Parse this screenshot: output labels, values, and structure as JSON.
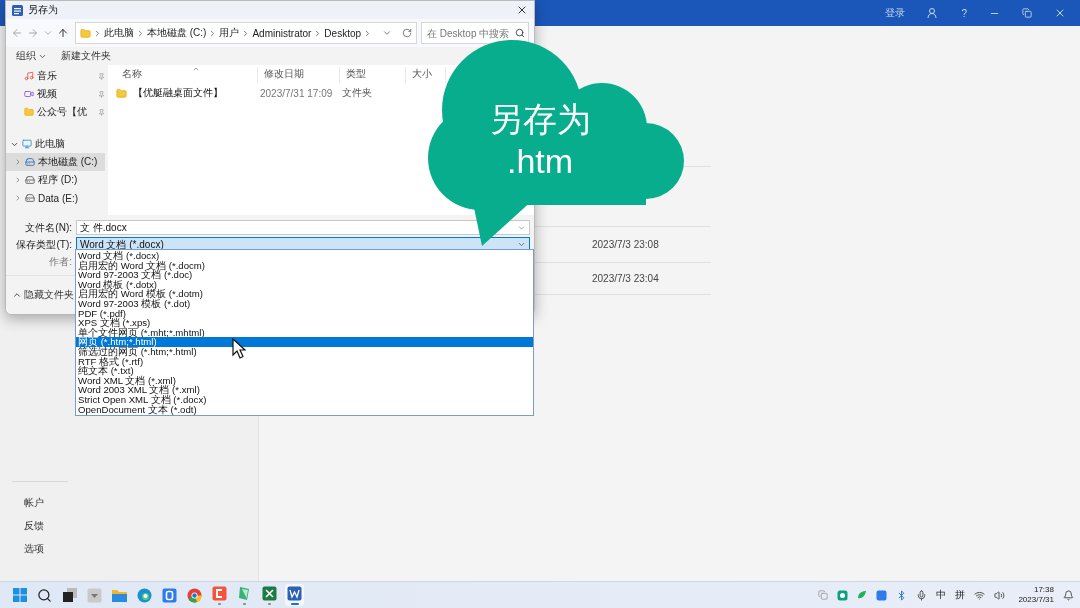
{
  "word_window": {
    "sign_in": "登录",
    "help": "?"
  },
  "backstage": {
    "bottom_items": [
      "帐户",
      "反馈",
      "选项"
    ],
    "recent_rows": [
      {
        "date": "2023/7/3 23:08"
      },
      {
        "date": "2023/7/3 23:04"
      }
    ]
  },
  "dialog": {
    "title": "另存为",
    "nav_buttons": [
      {
        "kind": "back",
        "disabled": true
      },
      {
        "kind": "forward",
        "disabled": true
      },
      {
        "kind": "recent",
        "disabled": true
      },
      {
        "kind": "up",
        "disabled": false
      }
    ],
    "address": [
      "此电脑",
      "本地磁盘 (C:)",
      "用户",
      "Administrator",
      "Desktop"
    ],
    "search": {
      "placeholder": "在 Desktop 中搜索"
    },
    "toolbar": [
      {
        "label": "组织",
        "menu": true
      },
      {
        "label": "新建文件夹",
        "menu": false
      }
    ],
    "quick_access": [
      {
        "label": "音乐",
        "kind": "music",
        "pinned": true
      },
      {
        "label": "视频",
        "kind": "video",
        "pinned": true
      },
      {
        "label": "公众号【优",
        "kind": "folder",
        "pinned": true
      }
    ],
    "tree": [
      {
        "label": "此电脑",
        "kind": "pc",
        "expanded": true,
        "selected": false,
        "children": [
          {
            "label": "本地磁盘 (C:)",
            "kind": "system-drive",
            "expanded": false,
            "selected": true
          },
          {
            "label": "程序 (D:)",
            "kind": "drive",
            "expanded": false,
            "selected": false
          },
          {
            "label": "Data (E:)",
            "kind": "drive",
            "expanded": false,
            "selected": false
          }
        ]
      }
    ],
    "columns": [
      "名称",
      "修改日期",
      "类型",
      "大小"
    ],
    "files": [
      {
        "name": "【优艇融桌面文件】",
        "modified": "2023/7/31 17:09",
        "type": "文件夹"
      }
    ],
    "filename": {
      "label": "文件名(N):",
      "value": "文 件.docx"
    },
    "filetype": {
      "label": "保存类型(T):",
      "value": "Word 文档 (*.docx)"
    },
    "author": {
      "label": "作者:"
    },
    "hide_folders": "隐藏文件夹",
    "filetype_options": [
      {
        "label": "Word 文档 (*.docx)",
        "selected": false
      },
      {
        "label": "启用宏的 Word 文档 (*.docm)",
        "selected": false
      },
      {
        "label": "Word 97-2003 文档 (*.doc)",
        "selected": false
      },
      {
        "label": "Word 模板 (*.dotx)",
        "selected": false
      },
      {
        "label": "启用宏的 Word 模板 (*.dotm)",
        "selected": false
      },
      {
        "label": "Word 97-2003 模板 (*.dot)",
        "selected": false
      },
      {
        "label": "PDF (*.pdf)",
        "selected": false
      },
      {
        "label": "XPS 文档 (*.xps)",
        "selected": false
      },
      {
        "label": "单个文件网页 (*.mht;*.mhtml)",
        "selected": false
      },
      {
        "label": "网页 (*.htm;*.html)",
        "selected": true
      },
      {
        "label": "筛选过的网页 (*.htm;*.html)",
        "selected": false
      },
      {
        "label": "RTF 格式 (*.rtf)",
        "selected": false
      },
      {
        "label": "纯文本 (*.txt)",
        "selected": false
      },
      {
        "label": "Word XML 文档 (*.xml)",
        "selected": false
      },
      {
        "label": "Word 2003 XML 文档 (*.xml)",
        "selected": false
      },
      {
        "label": "Strict Open XML 文档 (*.docx)",
        "selected": false
      },
      {
        "label": "OpenDocument 文本 (*.odt)",
        "selected": false
      }
    ]
  },
  "callout": {
    "lines": [
      "另存为",
      ".htm"
    ]
  },
  "taskbar": {
    "apps": [
      {
        "kind": "start",
        "running": false,
        "active": false
      },
      {
        "kind": "search",
        "running": false,
        "active": false
      },
      {
        "kind": "taskview",
        "running": false,
        "active": false
      },
      {
        "kind": "grey",
        "running": false,
        "active": false
      },
      {
        "kind": "explorer",
        "running": false,
        "active": false
      },
      {
        "kind": "edge",
        "running": false,
        "active": false
      },
      {
        "kind": "blue",
        "running": false,
        "active": false
      },
      {
        "kind": "chrome",
        "running": false,
        "active": false
      },
      {
        "kind": "red",
        "running": true,
        "active": false
      },
      {
        "kind": "green",
        "running": true,
        "active": false
      },
      {
        "kind": "excel",
        "running": true,
        "active": false
      },
      {
        "kind": "word",
        "running": true,
        "active": true
      }
    ],
    "ime": [
      "中",
      "拼"
    ],
    "time": "17:38",
    "date": "2023/7/31"
  }
}
